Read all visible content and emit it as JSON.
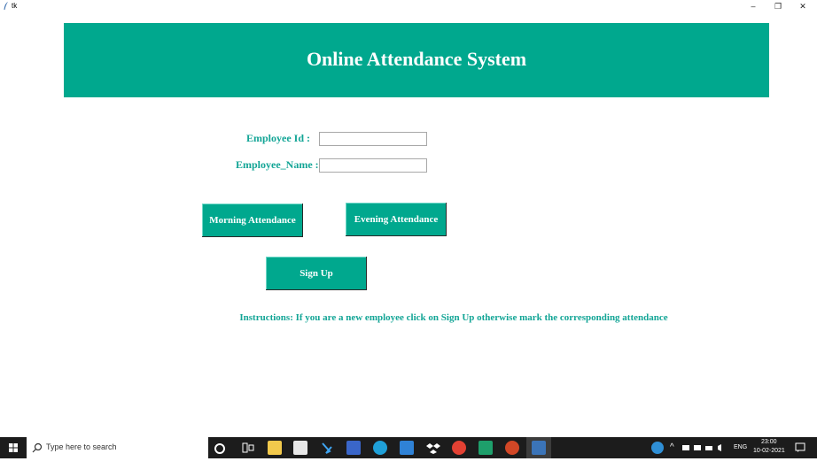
{
  "window": {
    "title": "tk",
    "controls": {
      "minimize": "–",
      "maximize": "❐",
      "close": "✕"
    }
  },
  "header": {
    "title": "Online Attendance System"
  },
  "form": {
    "employee_id_label": "Employee Id :",
    "employee_id_value": "",
    "employee_name_label": "Employee_Name :",
    "employee_name_value": ""
  },
  "buttons": {
    "morning": "Morning Attendance",
    "evening": "Evening Attendance",
    "signup": "Sign Up"
  },
  "instructions": "Instructions: If you are a new employee click on Sign Up otherwise mark the corresponding attendance",
  "colors": {
    "accent": "#00a88e",
    "label_text": "#13a596"
  },
  "taskbar": {
    "search_placeholder": "Type here to search",
    "language": "ENG",
    "time": "23:00",
    "date": "10-02-2021",
    "icons": [
      "cortana-icon",
      "task-view-icon",
      "file-explorer-icon",
      "store-icon",
      "vscode-icon",
      "news-icon",
      "edge-icon",
      "mail-icon",
      "dropbox-icon",
      "chrome-icon",
      "pycharm-icon",
      "powerpoint-icon",
      "python-tk-icon"
    ]
  }
}
